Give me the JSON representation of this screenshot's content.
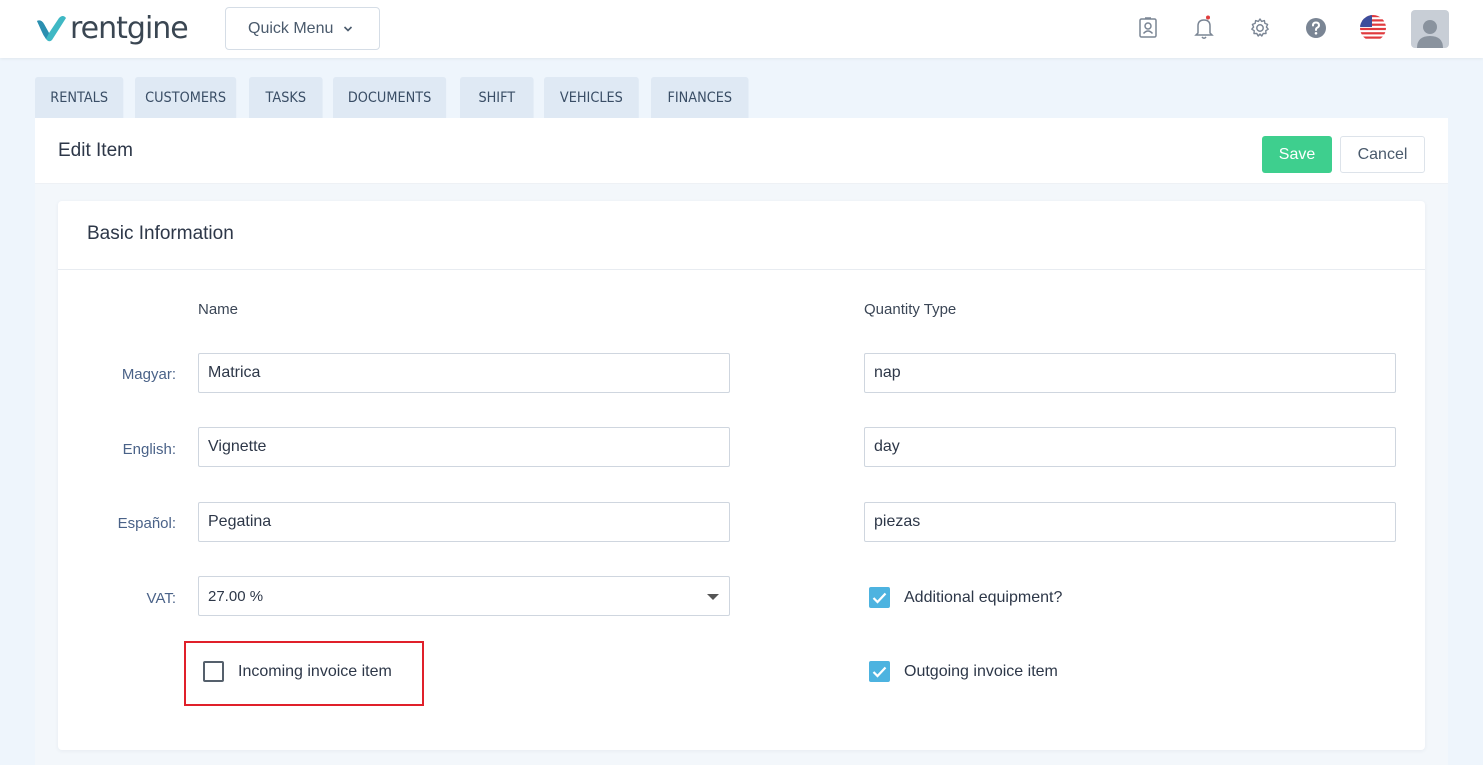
{
  "app": {
    "logo_text": "rentgine"
  },
  "topbar": {
    "quick_menu_label": "Quick Menu",
    "notification_dot_color": "#e03d3d"
  },
  "tabs": [
    {
      "label": "RENTALS"
    },
    {
      "label": "CUSTOMERS"
    },
    {
      "label": "TASKS"
    },
    {
      "label": "DOCUMENTS"
    },
    {
      "label": "SHIFT"
    },
    {
      "label": "VEHICLES"
    },
    {
      "label": "FINANCES"
    }
  ],
  "page": {
    "title": "Edit Item",
    "save_label": "Save",
    "cancel_label": "Cancel"
  },
  "basic_info": {
    "title": "Basic Information",
    "name_header": "Name",
    "quantity_header": "Quantity Type",
    "rows": [
      {
        "label": "Magyar:",
        "name": "Matrica",
        "quantity": "nap"
      },
      {
        "label": "English:",
        "name": "Vignette",
        "quantity": "day"
      },
      {
        "label": "Español:",
        "name": "Pegatina",
        "quantity": "piezas"
      }
    ],
    "vat_label": "VAT:",
    "vat_value": "27.00 %",
    "additional_equipment": {
      "label": "Additional equipment?",
      "checked": true
    },
    "incoming_invoice": {
      "label": "Incoming invoice item",
      "checked": false
    },
    "outgoing_invoice": {
      "label": "Outgoing invoice item",
      "checked": true
    }
  },
  "colors": {
    "accent_green": "#3ecf8e",
    "checkbox_blue": "#4db3e0",
    "highlight_red": "#e0202a",
    "tab_bg": "#dfe9f4"
  }
}
